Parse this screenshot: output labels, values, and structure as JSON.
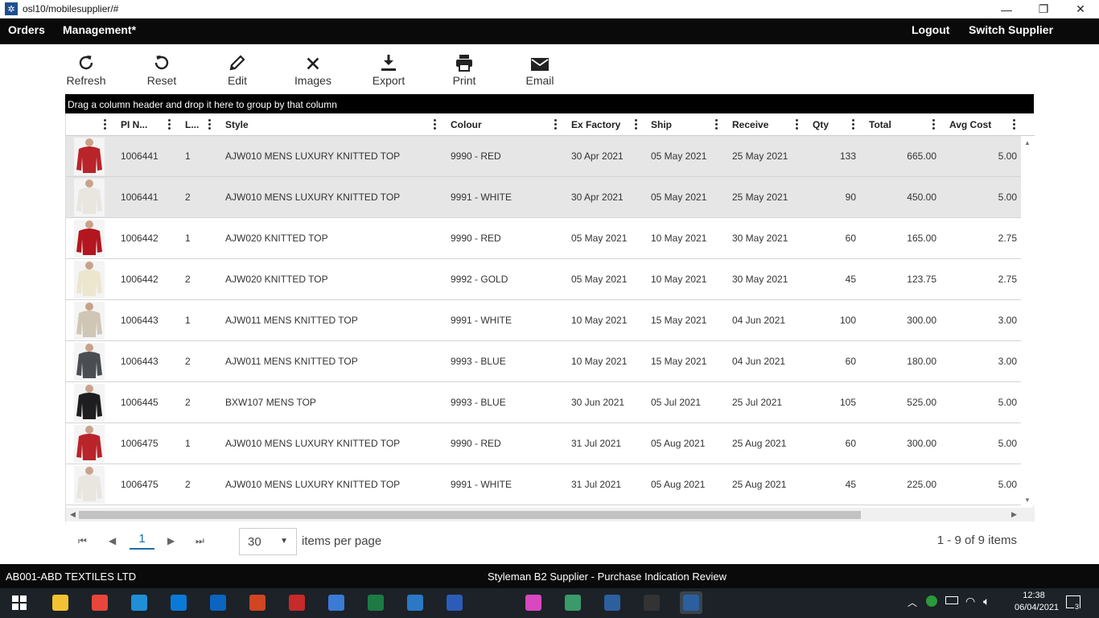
{
  "window": {
    "title": "osl10/mobilesupplier/#",
    "minimize": "—",
    "restore": "❐",
    "close": "✕"
  },
  "nav": {
    "orders": "Orders",
    "management": "Management*",
    "logout": "Logout",
    "switch_supplier": "Switch Supplier"
  },
  "toolbar": [
    {
      "label": "Refresh",
      "icon": "refresh-icon"
    },
    {
      "label": "Reset",
      "icon": "reset-icon"
    },
    {
      "label": "Edit",
      "icon": "pencil-icon"
    },
    {
      "label": "Images",
      "icon": "close-icon"
    },
    {
      "label": "Export",
      "icon": "download-icon"
    },
    {
      "label": "Print",
      "icon": "printer-icon"
    },
    {
      "label": "Email",
      "icon": "envelope-icon"
    }
  ],
  "grid": {
    "group_hint": "Drag a column header and drop it here to group by that column",
    "columns": [
      "",
      "PI N...",
      "L...",
      "Style",
      "Colour",
      "Ex Factory",
      "Ship",
      "Receive",
      "Qty",
      "Total",
      "Avg Cost"
    ],
    "rows": [
      {
        "pi": "1006441",
        "line": "1",
        "style": "AJW010 MENS LUXURY KNITTED TOP",
        "colour": "9990 - RED",
        "ex_factory": "30 Apr 2021",
        "ship": "05 May 2021",
        "receive": "25 May 2021",
        "qty": "133",
        "total": "665.00",
        "avg_cost": "5.00",
        "thumb": "#b8242a",
        "selected": true
      },
      {
        "pi": "1006441",
        "line": "2",
        "style": "AJW010 MENS LUXURY KNITTED TOP",
        "colour": "9991 - WHITE",
        "ex_factory": "30 Apr 2021",
        "ship": "05 May 2021",
        "receive": "25 May 2021",
        "qty": "90",
        "total": "450.00",
        "avg_cost": "5.00",
        "thumb": "#e8e6df",
        "selected": true
      },
      {
        "pi": "1006442",
        "line": "1",
        "style": "AJW020 KNITTED TOP",
        "colour": "9990 - RED",
        "ex_factory": "05 May 2021",
        "ship": "10 May 2021",
        "receive": "30 May 2021",
        "qty": "60",
        "total": "165.00",
        "avg_cost": "2.75",
        "thumb": "#b3161e",
        "selected": false
      },
      {
        "pi": "1006442",
        "line": "2",
        "style": "AJW020 KNITTED TOP",
        "colour": "9992 - GOLD",
        "ex_factory": "05 May 2021",
        "ship": "10 May 2021",
        "receive": "30 May 2021",
        "qty": "45",
        "total": "123.75",
        "avg_cost": "2.75",
        "thumb": "#ece6cf",
        "selected": false
      },
      {
        "pi": "1006443",
        "line": "1",
        "style": "AJW011 MENS KNITTED TOP",
        "colour": "9991 - WHITE",
        "ex_factory": "10 May 2021",
        "ship": "15 May 2021",
        "receive": "04 Jun 2021",
        "qty": "100",
        "total": "300.00",
        "avg_cost": "3.00",
        "thumb": "#cfc6b6",
        "selected": false
      },
      {
        "pi": "1006443",
        "line": "2",
        "style": "AJW011 MENS KNITTED TOP",
        "colour": "9993 - BLUE",
        "ex_factory": "10 May 2021",
        "ship": "15 May 2021",
        "receive": "04 Jun 2021",
        "qty": "60",
        "total": "180.00",
        "avg_cost": "3.00",
        "thumb": "#4a4d52",
        "selected": false
      },
      {
        "pi": "1006445",
        "line": "2",
        "style": "BXW107 MENS TOP",
        "colour": "9993 - BLUE",
        "ex_factory": "30 Jun 2021",
        "ship": "05 Jul 2021",
        "receive": "25 Jul 2021",
        "qty": "105",
        "total": "525.00",
        "avg_cost": "5.00",
        "thumb": "#1e1e20",
        "selected": false
      },
      {
        "pi": "1006475",
        "line": "1",
        "style": "AJW010 MENS LUXURY KNITTED TOP",
        "colour": "9990 - RED",
        "ex_factory": "31 Jul 2021",
        "ship": "05 Aug 2021",
        "receive": "25 Aug 2021",
        "qty": "60",
        "total": "300.00",
        "avg_cost": "5.00",
        "thumb": "#b8242a",
        "selected": false
      },
      {
        "pi": "1006475",
        "line": "2",
        "style": "AJW010 MENS LUXURY KNITTED TOP",
        "colour": "9991 - WHITE",
        "ex_factory": "31 Jul 2021",
        "ship": "05 Aug 2021",
        "receive": "25 Aug 2021",
        "qty": "45",
        "total": "225.00",
        "avg_cost": "5.00",
        "thumb": "#e8e6df",
        "selected": false
      }
    ]
  },
  "pager": {
    "first": "⏮",
    "prev": "◀",
    "page": "1",
    "next": "▶",
    "last": "⏭",
    "page_size": "30",
    "items_per_page": "items per page",
    "info": "1 - 9 of 9 items"
  },
  "status": {
    "left": "AB001-ABD TEXTILES LTD",
    "center": "Styleman B2 Supplier - Purchase Indication Review"
  },
  "taskbar": {
    "apps": [
      {
        "name": "file-explorer-icon",
        "color": "#f2c230"
      },
      {
        "name": "chrome-icon",
        "color": "#e8453c"
      },
      {
        "name": "edge-icon",
        "color": "#1f8fd8"
      },
      {
        "name": "store-icon",
        "color": "#0a7ad8"
      },
      {
        "name": "outlook-icon",
        "color": "#0b64c0"
      },
      {
        "name": "powerpoint-icon",
        "color": "#d04523"
      },
      {
        "name": "wt-icon",
        "color": "#c62a2a"
      },
      {
        "name": "network-app-icon",
        "color": "#3b7bd6"
      },
      {
        "name": "excel-icon",
        "color": "#1d7a43"
      },
      {
        "name": "remote-desktop-icon",
        "color": "#2b78c4"
      },
      {
        "name": "word-icon",
        "color": "#2b5cb8"
      },
      {
        "name": "app-pink-icon",
        "color": "#d848c0"
      },
      {
        "name": "globe-app-icon",
        "color": "#3a9a6a"
      },
      {
        "name": "styleman-icon",
        "color": "#2c5f9e"
      },
      {
        "name": "terminal-icon",
        "color": "#333333"
      },
      {
        "name": "styleman-active-icon",
        "color": "#2c5f9e"
      }
    ],
    "time": "12:38",
    "date": "06/04/2021",
    "notifications": "3"
  }
}
